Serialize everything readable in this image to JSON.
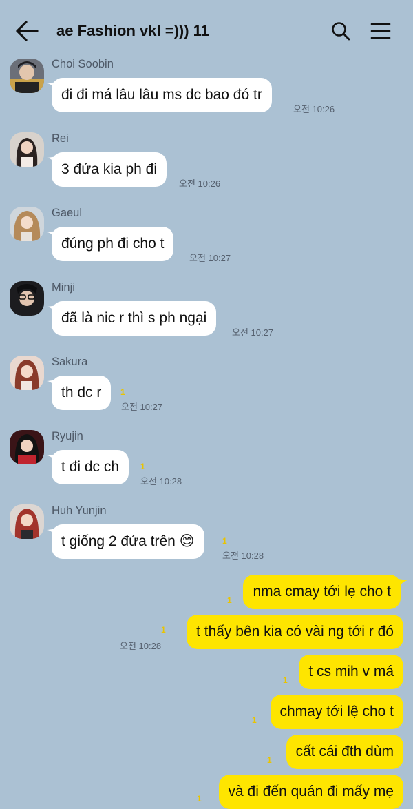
{
  "header": {
    "title": "ae Fashion vkl =))) 11",
    "back_icon": "back-arrow-icon",
    "search_icon": "search-icon",
    "menu_icon": "menu-icon"
  },
  "colors": {
    "background": "#abc1d3",
    "incoming_bubble": "#ffffff",
    "outgoing_bubble": "#fee500",
    "unread_count": "#e9c400"
  },
  "incoming": [
    {
      "sender": "Choi Soobin",
      "text": "đi đi má lâu lâu ms dc bao đó tr",
      "time": "오전 10:26",
      "unread": ""
    },
    {
      "sender": "Rei",
      "text": "3 đứa kia ph đi",
      "time": "오전 10:26",
      "unread": ""
    },
    {
      "sender": "Gaeul",
      "text": "đúng ph đi cho t",
      "time": "오전 10:27",
      "unread": ""
    },
    {
      "sender": "Minji",
      "text": "đã là nic r thì s ph ngại",
      "time": "오전 10:27",
      "unread": ""
    },
    {
      "sender": "Sakura",
      "text": "th dc r",
      "time": "오전 10:27",
      "unread": "1"
    },
    {
      "sender": "Ryujin",
      "text": "t đi dc ch",
      "time": "오전 10:28",
      "unread": "1"
    },
    {
      "sender": "Huh Yunjin",
      "text": "t giống 2 đứa trên 😊",
      "time": "오전 10:28",
      "unread": "1"
    }
  ],
  "outgoing": [
    {
      "text": "nma cmay tới lẹ cho t",
      "unread": "1",
      "time": ""
    },
    {
      "text": "t thấy bên kia có vài ng tới r đó",
      "unread": "1",
      "time": "오전 10:28"
    },
    {
      "text": "t cs mih v má",
      "unread": "1",
      "time": ""
    },
    {
      "text": "chmay tới lệ cho t",
      "unread": "1",
      "time": ""
    },
    {
      "text": "cất cái đth dùm",
      "unread": "1",
      "time": ""
    },
    {
      "text": "và đi đến quán đi mấy mẹ",
      "unread": "1",
      "time": ""
    }
  ]
}
